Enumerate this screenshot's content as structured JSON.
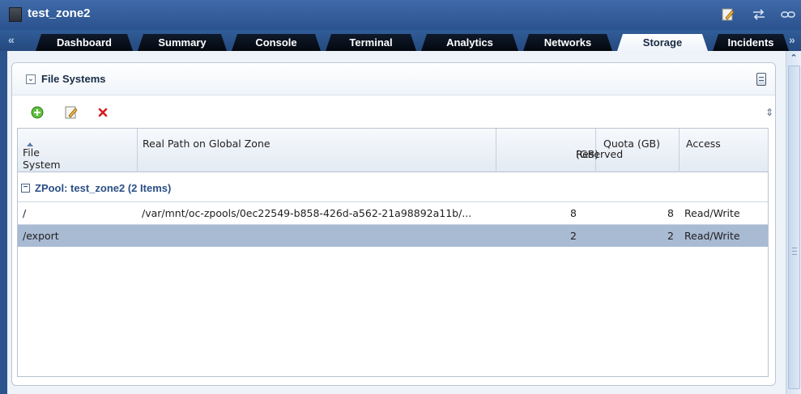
{
  "window": {
    "title": "test_zone2"
  },
  "tabs": [
    {
      "label": "Dashboard"
    },
    {
      "label": "Summary"
    },
    {
      "label": "Console"
    },
    {
      "label": "Terminal"
    },
    {
      "label": "Analytics"
    },
    {
      "label": "Networks"
    },
    {
      "label": "Storage",
      "active": true
    },
    {
      "label": "Incidents"
    }
  ],
  "tab_nav": {
    "prev": "«",
    "next": "»"
  },
  "panel": {
    "title": "File Systems",
    "collapse_glyph": "⌄"
  },
  "toolbar": {
    "add_icon": "add-icon",
    "edit_icon": "edit-icon",
    "delete_icon": "delete-icon",
    "refresh_glyph": "⇕"
  },
  "table": {
    "columns": {
      "file_system": "File System",
      "real_path": "Real Path on Global Zone",
      "reserved_line1": "Reserved",
      "reserved_line2": "(GB)",
      "quota": "Quota (GB)",
      "access": "Access"
    },
    "group": {
      "toggle_glyph": "−",
      "label": "ZPool: test_zone2 (2 Items)"
    },
    "rows": [
      {
        "file_system": "/",
        "real_path": "/var/mnt/oc-zpools/0ec22549-b858-426d-a562-21a98892a11b/...",
        "reserved": "8",
        "quota": "8",
        "access": "Read/Write",
        "selected": false
      },
      {
        "file_system": "/export",
        "real_path": "",
        "reserved": "2",
        "quota": "2",
        "access": "Read/Write",
        "selected": true
      }
    ]
  },
  "colors": {
    "titlebar": "#2f5a96",
    "selected_row": "#a9bad3",
    "group_text": "#2b4f86"
  }
}
